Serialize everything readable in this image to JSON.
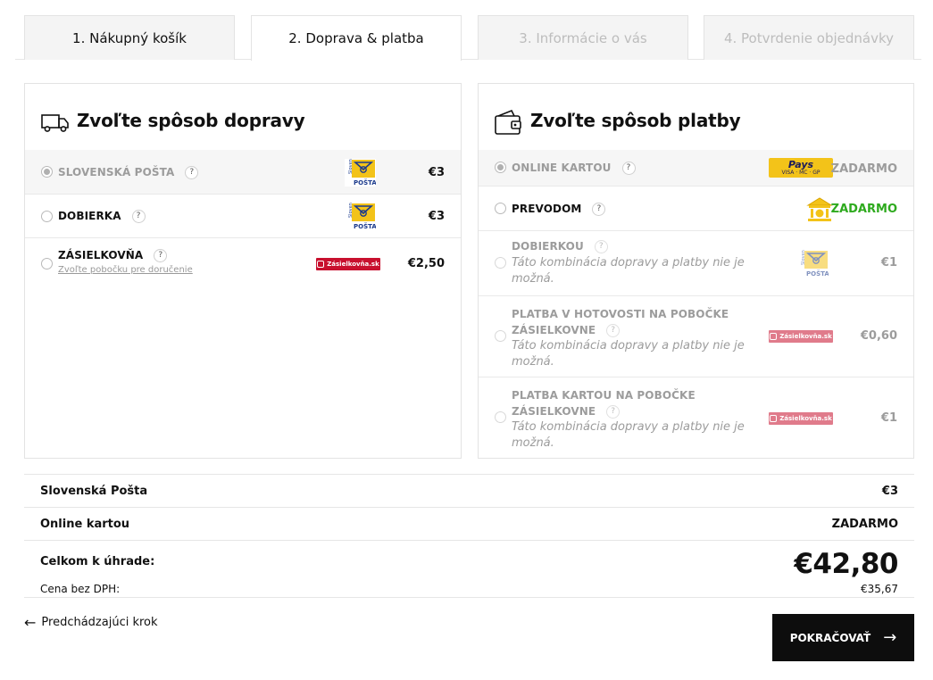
{
  "tabs": [
    {
      "label": "1. Nákupný košík",
      "state": "done"
    },
    {
      "label": "2. Doprava & platba",
      "state": "active"
    },
    {
      "label": "3. Informácie o vás",
      "state": "disabled"
    },
    {
      "label": "4. Potvrdenie objednávky",
      "state": "disabled"
    }
  ],
  "shipping": {
    "title": "Zvoľte spôsob dopravy",
    "icon": "truck-icon",
    "options": [
      {
        "label": "SLOVENSKÁ POŠTA",
        "help": "?",
        "logo": "slovenska-posta-logo",
        "logo_text": "Slovenská POŠTA",
        "price": "€3",
        "selected": true
      },
      {
        "label": "DOBIERKA",
        "help": "?",
        "logo": "slovenska-posta-logo",
        "logo_text": "Slovenská POŠTA",
        "price": "€3",
        "selected": false
      },
      {
        "label": "ZÁSIELKOVŇA",
        "help": "?",
        "sublink": "Zvoľte pobočku pre doručenie",
        "logo": "zasielkovna-logo",
        "logo_text": "Zásielkovňa.sk",
        "price": "€2,50",
        "selected": false
      }
    ]
  },
  "payment": {
    "title": "Zvoľte spôsob platby",
    "icon": "wallet-icon",
    "options": [
      {
        "label": "ONLINE KARTOU",
        "help": "?",
        "logo": "pays-logo",
        "logo_text": "Pays",
        "logo_sub": "VISA · MC · GP",
        "price": "ZADARMO",
        "selected": true,
        "disabled": false
      },
      {
        "label": "PREVODOM",
        "help": "?",
        "logo": "bank-icon",
        "price": "ZADARMO",
        "selected": false,
        "disabled": false
      },
      {
        "label": "DOBIERKOU",
        "help": "?",
        "note": "Táto kombinácia dopravy a platby nie je možná.",
        "logo": "slovenska-posta-logo",
        "logo_text": "Slovenská POŠTA",
        "price": "€1",
        "disabled": true
      },
      {
        "label_line1": "PLATBA V HOTOVOSTI NA POBOČKE",
        "label_line2": "ZÁSIELKOVNE",
        "help": "?",
        "note": "Táto kombinácia dopravy a platby nie je možná.",
        "logo": "zasielkovna-logo",
        "logo_text": "Zásielkovňa.sk",
        "price": "€0,60",
        "disabled": true
      },
      {
        "label_line1": "PLATBA KARTOU NA POBOČKE",
        "label_line2": "ZÁSIELKOVNE",
        "help": "?",
        "note": "Táto kombinácia dopravy a platby nie je možná.",
        "logo": "zasielkovna-logo",
        "logo_text": "Zásielkovňa.sk",
        "price": "€1",
        "disabled": true
      }
    ]
  },
  "summary": {
    "shipping_label": "Slovenská Pošta",
    "shipping_price": "€3",
    "payment_label": "Online kartou",
    "payment_price": "ZADARMO",
    "total_label": "Celkom k úhrade:",
    "total_value": "€42,80",
    "net_label": "Cena bez DPH:",
    "net_value": "€35,67"
  },
  "nav": {
    "back_label": "Predchádzajúci krok",
    "continue_label": "POKRAČOVAŤ"
  },
  "colors": {
    "green": "#2eaa1e",
    "zasielkovna_red": "#c8102e",
    "pays_yellow": "#f3c319",
    "button_black": "#0d0d0d"
  }
}
